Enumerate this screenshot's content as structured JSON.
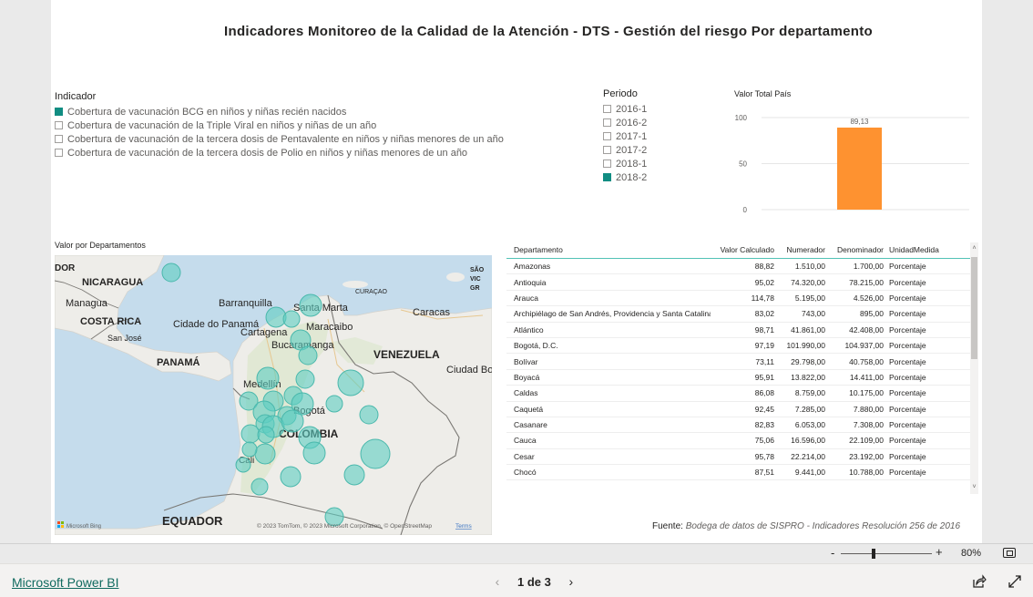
{
  "report": {
    "title": "Indicadores Monitoreo de la Calidad de la Atención - DTS - Gestión del riesgo Por departamento"
  },
  "indicador_slicer": {
    "header": "Indicador",
    "items": [
      {
        "label": "Cobertura de vacunación BCG en niños y niñas recién nacidos",
        "selected": true
      },
      {
        "label": "Cobertura de vacunación de la Triple Viral en niños y niñas de un año",
        "selected": false
      },
      {
        "label": "Cobertura de vacunación de la tercera dosis de Pentavalente en niños y niñas menores de un año",
        "selected": false
      },
      {
        "label": "Cobertura de vacunación de la tercera dosis de Polio en niños y niñas menores de un año",
        "selected": false
      }
    ]
  },
  "periodo_slicer": {
    "header": "Periodo",
    "items": [
      {
        "label": "2016-1",
        "selected": false
      },
      {
        "label": "2016-2",
        "selected": false
      },
      {
        "label": "2017-1",
        "selected": false
      },
      {
        "label": "2017-2",
        "selected": false
      },
      {
        "label": "2018-1",
        "selected": false
      },
      {
        "label": "2018-2",
        "selected": true
      }
    ]
  },
  "chart_data": {
    "type": "bar",
    "title": "Valor Total País",
    "categories": [
      ""
    ],
    "values": [
      89.13
    ],
    "data_labels": [
      "89,13"
    ],
    "yticks": [
      "100",
      "50",
      "0"
    ],
    "ylim": [
      0,
      100
    ],
    "grid": true,
    "bar_color": "#fe9230"
  },
  "map": {
    "title": "Valor por Departamentos",
    "bubble_color": "#5ecdc1",
    "labels": {
      "nicaragua": "NICARAGUA",
      "managua": "Managua",
      "costa_rica": "COSTA RICA",
      "san_jose": "San José",
      "panama_city": "Cidade do Panamá",
      "panama": "PANAMÁ",
      "barranquilla": "Barranquilla",
      "santa_marta": "Santa Marta",
      "curacao": "CURAÇAO",
      "caracas": "Caracas",
      "cartagena": "Cartagena",
      "maracaibo": "Maracaibo",
      "venezuela": "VENEZUELA",
      "bucaramanga": "Bucaramanga",
      "ciudad_bolivar": "Ciudad Bolívar",
      "medellin": "Medellín",
      "bogota": "Bogotá",
      "colombia": "COLOMBIA",
      "cali": "Cali",
      "equador": "EQUADOR",
      "sao": "SÃO",
      "vic": "VIC",
      "gr": "GR",
      "dor": "DOR"
    },
    "attribution": "© 2023 TomTom, © 2023 Microsoft Corporation, © OpenStreetMap",
    "terms": "Terms",
    "bing_logo": "Microsoft Bing"
  },
  "table": {
    "columns": [
      "Departamento",
      "Valor Calculado",
      "Numerador",
      "Denominador",
      "UnidadMedida"
    ],
    "rows": [
      [
        "Amazonas",
        "88,82",
        "1.510,00",
        "1.700,00",
        "Porcentaje"
      ],
      [
        "Antioquia",
        "95,02",
        "74.320,00",
        "78.215,00",
        "Porcentaje"
      ],
      [
        "Arauca",
        "114,78",
        "5.195,00",
        "4.526,00",
        "Porcentaje"
      ],
      [
        "Archipiélago de San Andrés, Providencia y Santa Catalina",
        "83,02",
        "743,00",
        "895,00",
        "Porcentaje"
      ],
      [
        "Atlántico",
        "98,71",
        "41.861,00",
        "42.408,00",
        "Porcentaje"
      ],
      [
        "Bogotá, D.C.",
        "97,19",
        "101.990,00",
        "104.937,00",
        "Porcentaje"
      ],
      [
        "Bolívar",
        "73,11",
        "29.798,00",
        "40.758,00",
        "Porcentaje"
      ],
      [
        "Boyacá",
        "95,91",
        "13.822,00",
        "14.411,00",
        "Porcentaje"
      ],
      [
        "Caldas",
        "86,08",
        "8.759,00",
        "10.175,00",
        "Porcentaje"
      ],
      [
        "Caquetá",
        "92,45",
        "7.285,00",
        "7.880,00",
        "Porcentaje"
      ],
      [
        "Casanare",
        "82,83",
        "6.053,00",
        "7.308,00",
        "Porcentaje"
      ],
      [
        "Cauca",
        "75,06",
        "16.596,00",
        "22.109,00",
        "Porcentaje"
      ],
      [
        "Cesar",
        "95,78",
        "22.214,00",
        "23.192,00",
        "Porcentaje"
      ],
      [
        "Chocó",
        "87,51",
        "9.441,00",
        "10.788,00",
        "Porcentaje"
      ]
    ]
  },
  "source": {
    "prefix": "Fuente:",
    "text": "Bodega de datos de SISPRO - Indicadores Resolución 256 de 2016"
  },
  "zoom": {
    "minus": "-",
    "plus": "+",
    "level": "80%"
  },
  "footer": {
    "brand": "Microsoft Power BI",
    "page_indicator": "1 de 3"
  }
}
